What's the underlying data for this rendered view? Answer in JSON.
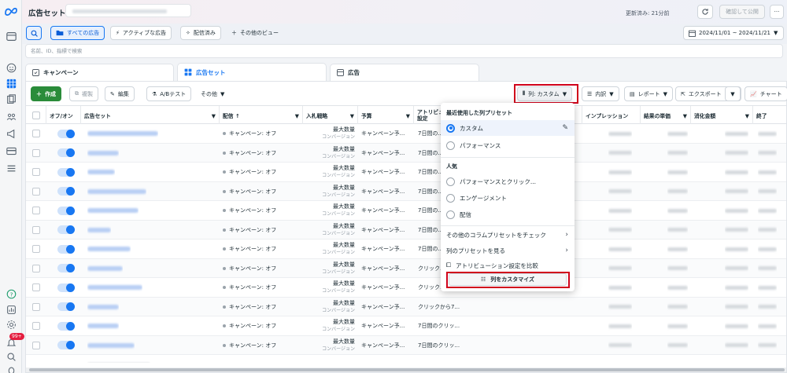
{
  "header": {
    "title": "広告セット",
    "updated": "更新済み: 21分前",
    "review_publish": "確認して公開",
    "more": "···"
  },
  "filters": {
    "all_ads": "すべての広告",
    "active_ads": "アクティブな広告",
    "delivered": "配信済み",
    "other_views": "その他のビュー",
    "date_range": "2024/11/01 ~ 2024/11/21"
  },
  "search": {
    "placeholder": "名前、ID、指標で検索"
  },
  "tabs": [
    {
      "label": "キャンペーン"
    },
    {
      "label": "広告セット"
    },
    {
      "label": "広告"
    }
  ],
  "toolbar": {
    "create": "作成",
    "duplicate": "複製",
    "edit": "編集",
    "ab_test": "A/Bテスト",
    "other": "その他",
    "columns": "列: カスタム",
    "breakdown": "内訳",
    "reports": "レポート",
    "export": "エクスポート",
    "chart": "チャート"
  },
  "table": {
    "headers": {
      "on_off": "オフ/オン",
      "ad_set": "広告セット",
      "delivery": "配信 ↑",
      "bid": "入札戦略",
      "budget": "予算",
      "attribution_1": "アトリビュ",
      "attribution_2": "設定",
      "impressions": "インプレッション",
      "cost_per_result": "結果の単価",
      "spend": "消化金額",
      "end": "終了"
    },
    "rows": [
      {
        "delivery": "キャンペーン: オフ",
        "bid_1": "最大数量",
        "bid_2": "コンバージョン",
        "budget": "キャンペーン予...",
        "attribution": "7日間の..."
      },
      {
        "delivery": "キャンペーン: オフ",
        "bid_1": "最大数量",
        "bid_2": "コンバージョン",
        "budget": "キャンペーン予...",
        "attribution": "7日間の..."
      },
      {
        "delivery": "キャンペーン: オフ",
        "bid_1": "最大数量",
        "bid_2": "コンバージョン",
        "budget": "キャンペーン予...",
        "attribution": "7日間の..."
      },
      {
        "delivery": "キャンペーン: オフ",
        "bid_1": "最大数量",
        "bid_2": "コンバージョン",
        "budget": "キャンペーン予...",
        "attribution": "7日間の..."
      },
      {
        "delivery": "キャンペーン: オフ",
        "bid_1": "最大数量",
        "bid_2": "コンバージョン",
        "budget": "キャンペーン予...",
        "attribution": "7日間の..."
      },
      {
        "delivery": "キャンペーン: オフ",
        "bid_1": "最大数量",
        "bid_2": "コンバージョン",
        "budget": "キャンペーン予...",
        "attribution": "7日間の..."
      },
      {
        "delivery": "キャンペーン: オフ",
        "bid_1": "最大数量",
        "bid_2": "コンバージョン",
        "budget": "キャンペーン予...",
        "attribution": "7日間の..."
      },
      {
        "delivery": "キャンペーン: オフ",
        "bid_1": "最大数量",
        "bid_2": "コンバージョン",
        "budget": "キャンペーン予...",
        "attribution": "クリック..."
      },
      {
        "delivery": "キャンペーン: オフ",
        "bid_1": "最大数量",
        "bid_2": "コンバージョン",
        "budget": "キャンペーン予...",
        "attribution": "クリック..."
      },
      {
        "delivery": "キャンペーン: オフ",
        "bid_1": "最大数量",
        "bid_2": "コンバージョン",
        "budget": "キャンペーン予...",
        "attribution": "クリックから7..."
      },
      {
        "delivery": "キャンペーン: オフ",
        "bid_1": "最大数量",
        "bid_2": "コンバージョン",
        "budget": "キャンペーン予...",
        "attribution": "7日間のクリッ..."
      },
      {
        "delivery": "キャンペーン: オフ",
        "bid_1": "最大数量",
        "bid_2": "コンバージョン",
        "budget": "キャンペーン予...",
        "attribution": "7日間のクリッ..."
      }
    ],
    "summary_dash": "—"
  },
  "dropdown": {
    "recent_heading": "最近使用した列プリセット",
    "custom": "カスタム",
    "performance": "パフォーマンス",
    "popular_heading": "人気",
    "perf_click": "パフォーマンスとクリック...",
    "engagement": "エンゲージメント",
    "delivery": "配信",
    "check_other": "その他のコラムプリセットをチェック",
    "view_presets": "列のプリセットを見る",
    "compare_attr": "アトリビューション設定を比較",
    "customize": "列をカスタマイズ"
  },
  "notification_badge": "99+",
  "colors": {
    "accent": "#1877f2",
    "create_green": "#2a8c3a",
    "highlight_red": "#d0021b"
  }
}
